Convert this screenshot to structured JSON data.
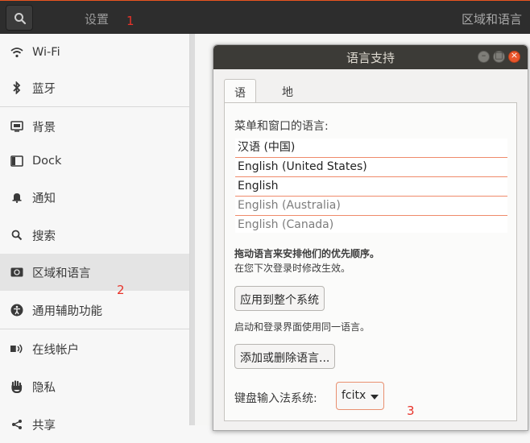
{
  "header": {
    "title": "设置",
    "right_title": "区域和语言",
    "search_icon": "search-icon"
  },
  "sidebar": {
    "items": [
      {
        "label": "Wi-Fi",
        "icon": "wifi-icon"
      },
      {
        "label": "蓝牙",
        "icon": "bluetooth-icon"
      },
      {
        "label": "背景",
        "icon": "background-icon"
      },
      {
        "label": "Dock",
        "icon": "dock-icon"
      },
      {
        "label": "通知",
        "icon": "bell-icon"
      },
      {
        "label": "搜索",
        "icon": "search-icon"
      },
      {
        "label": "区域和语言",
        "icon": "region-icon"
      },
      {
        "label": "通用辅助功能",
        "icon": "accessibility-icon"
      },
      {
        "label": "在线帐户",
        "icon": "online-accounts-icon"
      },
      {
        "label": "隐私",
        "icon": "privacy-hand-icon"
      },
      {
        "label": "共享",
        "icon": "share-icon"
      }
    ],
    "active": "区域和语言"
  },
  "dialog": {
    "title": "语言支持",
    "window_buttons": [
      "minimize",
      "maximize",
      "close"
    ],
    "tabs": [
      "语言",
      "地区格式"
    ],
    "menu_label": "菜单和窗口的语言:",
    "languages": [
      "汉语 (中国)",
      "English (United States)",
      "English",
      "English (Australia)",
      "English (Canada)"
    ],
    "drag_hint": "拖动语言来安排他们的优先顺序。",
    "login_hint": "在您下次登录时修改生效。",
    "apply_button": "应用到整个系统",
    "login_screen_hint": "启动和登录界面使用同一语言。",
    "add_remove_button": "添加或删除语言...",
    "keyboard_label": "键盘输入法系统:",
    "keyboard_value": "fcitx"
  },
  "annotations": [
    "1",
    "2",
    "3"
  ],
  "colors": {
    "accent": "#e95420",
    "header_bg": "#2d2d2d",
    "dialog_titlebar": "#3c3b37",
    "annotation": "#e8332a"
  }
}
